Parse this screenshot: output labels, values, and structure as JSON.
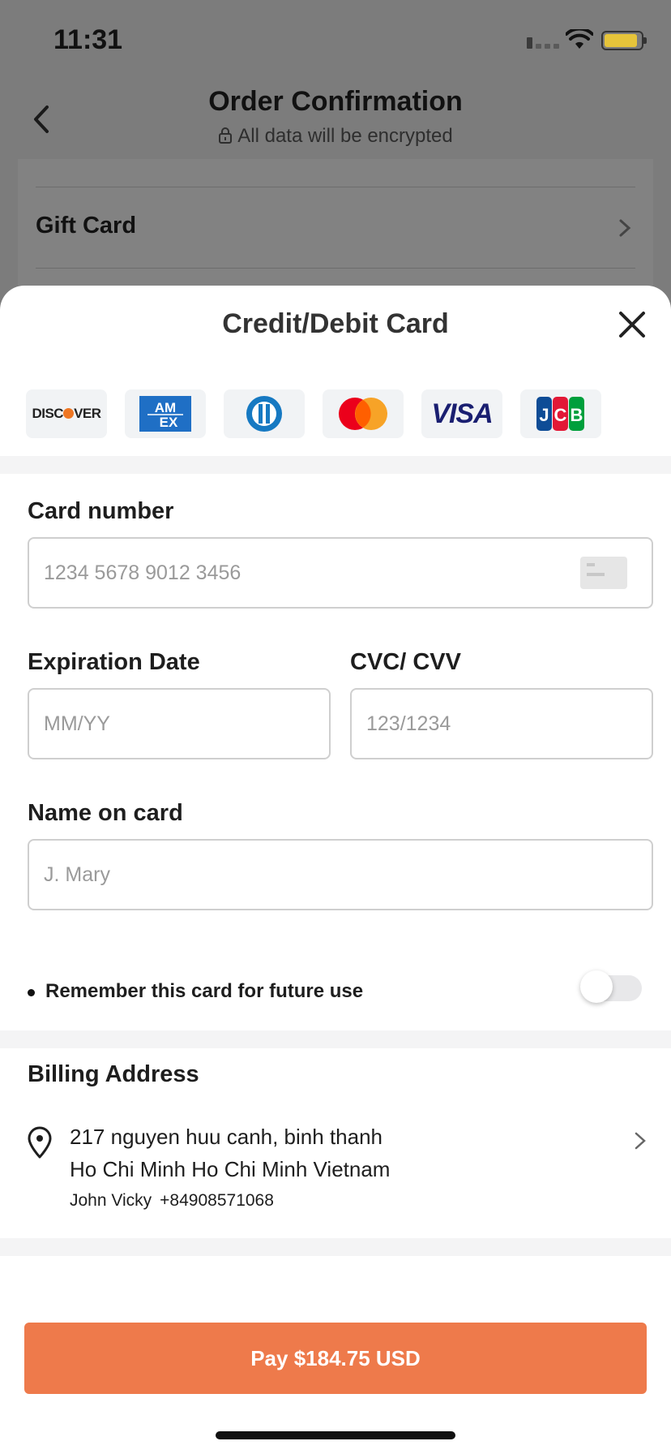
{
  "status_bar": {
    "time": "11:31"
  },
  "header": {
    "title": "Order Confirmation",
    "subtitle": "All data will be encrypted"
  },
  "background": {
    "gift_card_label": "Gift Card"
  },
  "sheet": {
    "title": "Credit/Debit Card",
    "card_logos": [
      {
        "name": "discover",
        "text": "DISC",
        "text2": "VER"
      },
      {
        "name": "amex",
        "line1": "AM",
        "line2": "EX"
      },
      {
        "name": "diners"
      },
      {
        "name": "mastercard"
      },
      {
        "name": "visa",
        "text": "VISA"
      },
      {
        "name": "jcb",
        "letters": [
          "J",
          "C",
          "B"
        ]
      }
    ],
    "card_number": {
      "label": "Card number",
      "placeholder": "1234 5678 9012 3456"
    },
    "expiration": {
      "label": "Expiration Date",
      "placeholder": "MM/YY"
    },
    "cvc": {
      "label": "CVC/ CVV",
      "placeholder": "123/1234"
    },
    "name_on_card": {
      "label": "Name on card",
      "placeholder": "J. Mary"
    },
    "remember": {
      "label": "Remember this card for future use",
      "enabled": false
    },
    "billing": {
      "title": "Billing Address",
      "line1": "217 nguyen huu canh, binh thanh",
      "line2": "Ho Chi Minh Ho Chi Minh Vietnam",
      "name": "John Vicky",
      "phone": "+84908571068"
    },
    "pay_button": "Pay $184.75 USD"
  },
  "colors": {
    "accent": "#ee7a4b",
    "overlay": "#7c7c7c",
    "visa_blue": "#1a1f71",
    "amex_blue": "#1f6fc5",
    "mastercard_red": "#eb001b",
    "mastercard_orange": "#f79e1b"
  },
  "icons": [
    "back-chevron-icon",
    "lock-icon",
    "chevron-right-icon",
    "close-icon",
    "credit-card-icon",
    "location-pin-icon"
  ]
}
